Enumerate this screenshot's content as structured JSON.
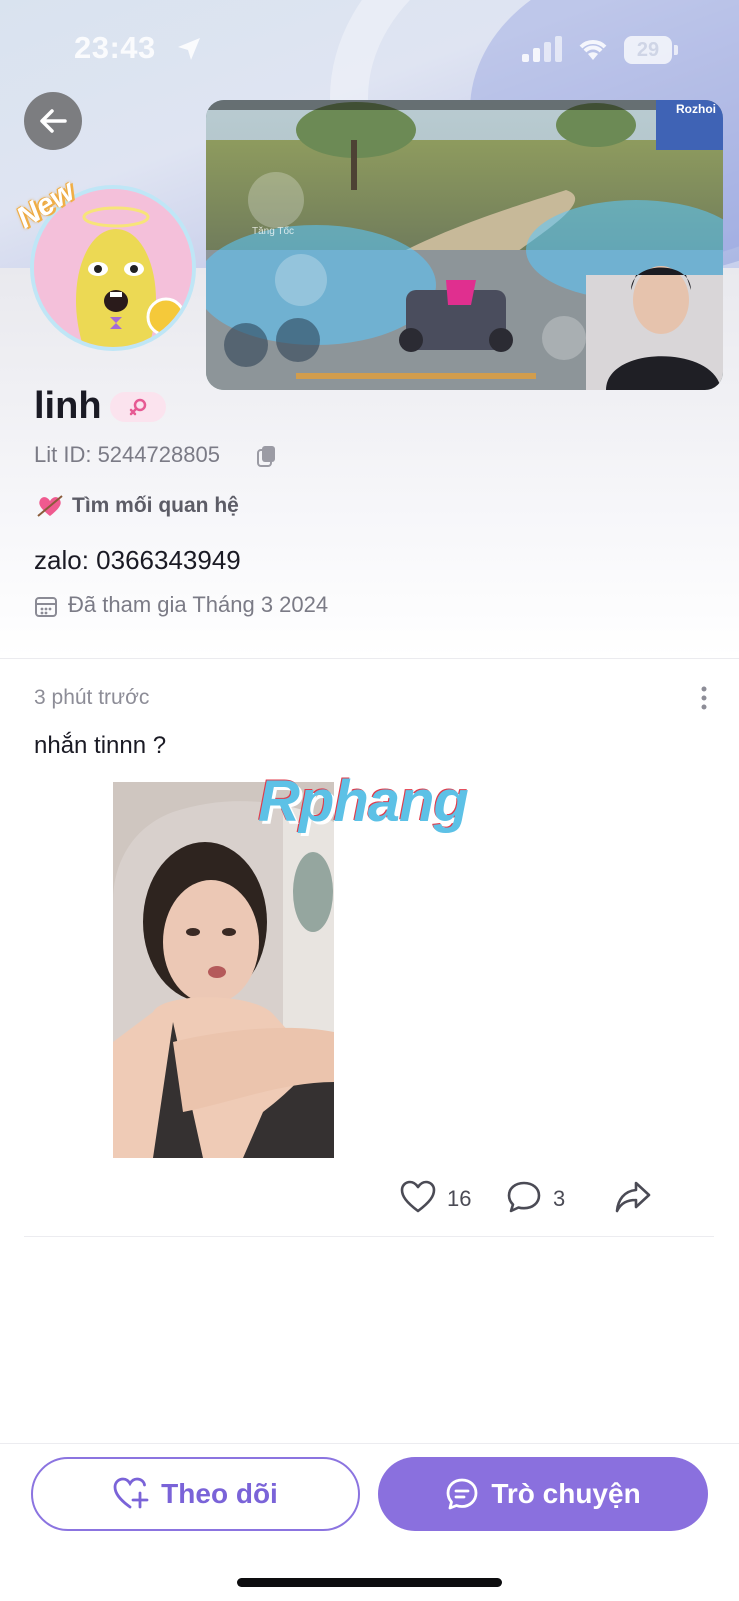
{
  "status_bar": {
    "time": "23:43",
    "battery": "29"
  },
  "profile": {
    "name": "linh",
    "lit_id": "Lit ID: 5244728805",
    "seeking": "Tìm mối quan hệ",
    "bio": "zalo: 0366343949",
    "joined": "Đã tham gia Tháng 3 2024",
    "new_badge": "New"
  },
  "post": {
    "time": "3 phút trước",
    "text": "nhắn tinnn ?",
    "watermark": "Rphang",
    "likes": "16",
    "comments": "3"
  },
  "pip_overlay": {
    "label": "Rozhoi",
    "hud_hint": "Tăng Tốc"
  },
  "actions": {
    "follow_label": "Theo dõi",
    "chat_label": "Trò chuyện"
  },
  "colors": {
    "accent": "#8a70de",
    "accent_text": "#7a63d8",
    "female": "#e65a93"
  }
}
